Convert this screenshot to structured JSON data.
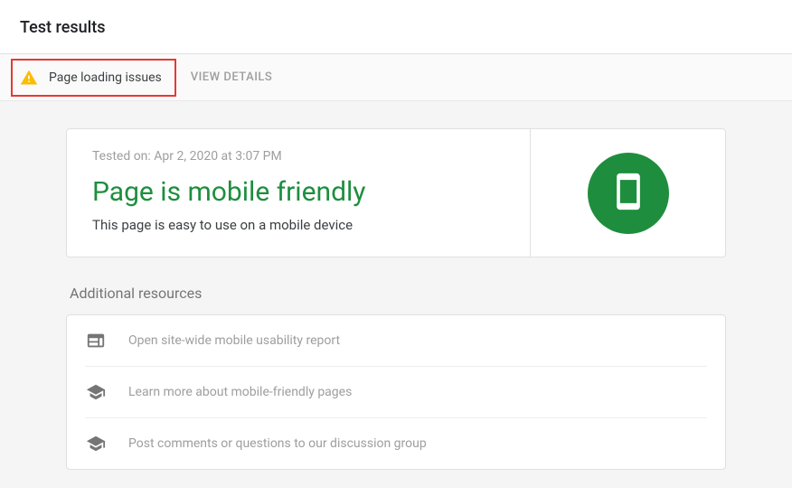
{
  "header": {
    "title": "Test results"
  },
  "issues": {
    "label": "Page loading issues",
    "view_details": "VIEW DETAILS"
  },
  "main": {
    "tested_on": "Tested on: Apr 2, 2020 at 3:07 PM",
    "verdict": "Page is mobile friendly",
    "subtext": "This page is easy to use on a mobile device"
  },
  "resources": {
    "title": "Additional resources",
    "items": [
      {
        "label": "Open site-wide mobile usability report",
        "icon": "web-icon"
      },
      {
        "label": "Learn more about mobile-friendly pages",
        "icon": "school-icon"
      },
      {
        "label": "Post comments or questions to our discussion group",
        "icon": "school-icon"
      }
    ]
  }
}
